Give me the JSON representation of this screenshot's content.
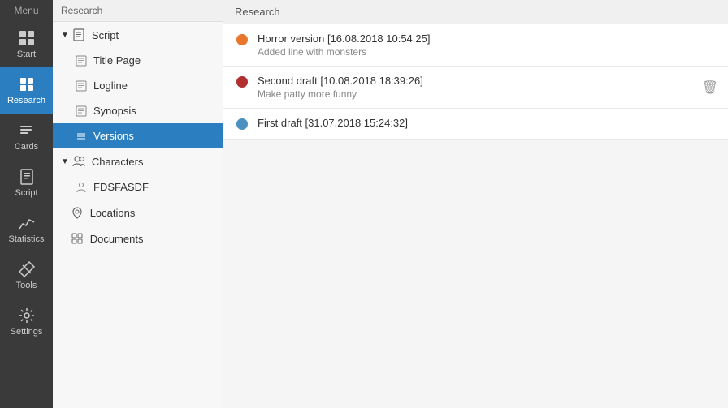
{
  "iconSidebar": {
    "items": [
      {
        "id": "start",
        "label": "Start",
        "icon": "grid"
      },
      {
        "id": "research",
        "label": "Research",
        "icon": "research",
        "active": true
      },
      {
        "id": "cards",
        "label": "Cards",
        "icon": "cards"
      },
      {
        "id": "script",
        "label": "Script",
        "icon": "script"
      },
      {
        "id": "statistics",
        "label": "Statistics",
        "icon": "statistics"
      },
      {
        "id": "tools",
        "label": "Tools",
        "icon": "tools"
      },
      {
        "id": "settings",
        "label": "Settings",
        "icon": "settings"
      }
    ]
  },
  "topBarLabel": "Research",
  "menuLabel": "Menu",
  "tree": {
    "sections": [
      {
        "id": "script",
        "label": "Script",
        "expanded": true,
        "children": [
          {
            "id": "title-page",
            "label": "Title Page"
          },
          {
            "id": "logline",
            "label": "Logline"
          },
          {
            "id": "synopsis",
            "label": "Synopsis"
          },
          {
            "id": "versions",
            "label": "Versions",
            "active": true
          }
        ]
      },
      {
        "id": "characters",
        "label": "Characters",
        "expanded": true,
        "children": [
          {
            "id": "fdsfasdf",
            "label": "FDSFASDF"
          }
        ]
      },
      {
        "id": "locations",
        "label": "Locations",
        "expanded": false,
        "children": []
      },
      {
        "id": "documents",
        "label": "Documents",
        "expanded": false,
        "children": []
      }
    ]
  },
  "versions": {
    "items": [
      {
        "id": "v1",
        "title": "Horror version [16.08.2018 10:54:25]",
        "subtitle": "Added line with monsters",
        "dotColor": "#e8762c",
        "showDelete": false
      },
      {
        "id": "v2",
        "title": "Second draft [10.08.2018 18:39:26]",
        "subtitle": "Make patty more funny",
        "dotColor": "#b03030",
        "showDelete": true
      },
      {
        "id": "v3",
        "title": "First draft [31.07.2018 15:24:32]",
        "subtitle": "",
        "dotColor": "#4a90c0",
        "showDelete": false
      }
    ]
  }
}
